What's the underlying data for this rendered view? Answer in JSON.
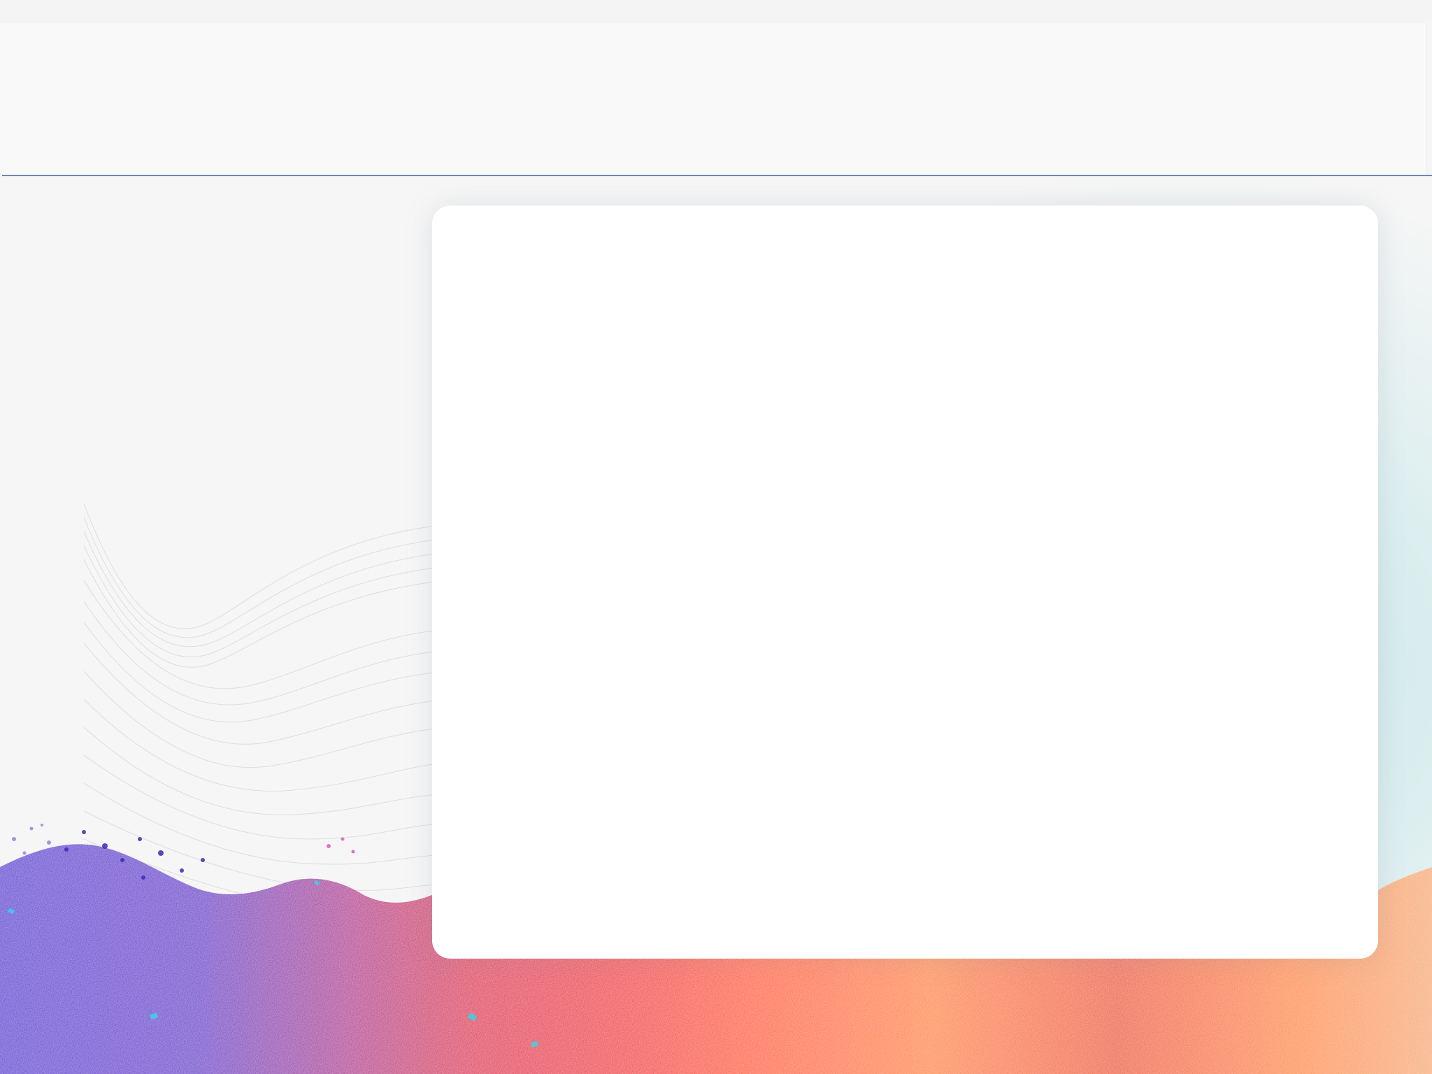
{
  "app": {
    "title": ""
  },
  "header": {
    "title": ""
  },
  "main": {
    "card": {
      "content": ""
    }
  },
  "colors": {
    "background": "#f6f6f6",
    "header": "#f9f9f9",
    "divider": "#6f86b0",
    "card": "#ffffff",
    "glow": "#b5e1e2"
  }
}
